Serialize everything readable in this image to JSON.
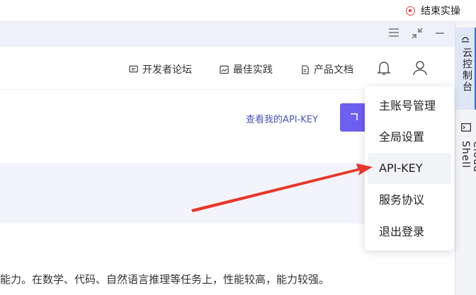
{
  "system_bar": {
    "stop_label": "结束实操"
  },
  "side_rail": {
    "console_label": "云控制台",
    "shell_label": "Cloud Shell"
  },
  "nav": {
    "forum": "开发者论坛",
    "best_practice": "最佳实践",
    "docs": "产品文档"
  },
  "content": {
    "view_apikey": "查看我的API-KEY",
    "body_text": "能力。在数学、代码、自然语言推理等任务上，性能较高，能力较强。"
  },
  "user_menu": {
    "items": [
      {
        "label": "主账号管理"
      },
      {
        "label": "全局设置"
      },
      {
        "label": "API-KEY"
      },
      {
        "label": "服务协议"
      },
      {
        "label": "退出登录"
      }
    ],
    "highlighted_index": 2
  },
  "colors": {
    "accent": "#6d5ff0",
    "link": "#4a56b8",
    "arrow": "#e8362a",
    "rail_active": "#2a6fd6"
  }
}
